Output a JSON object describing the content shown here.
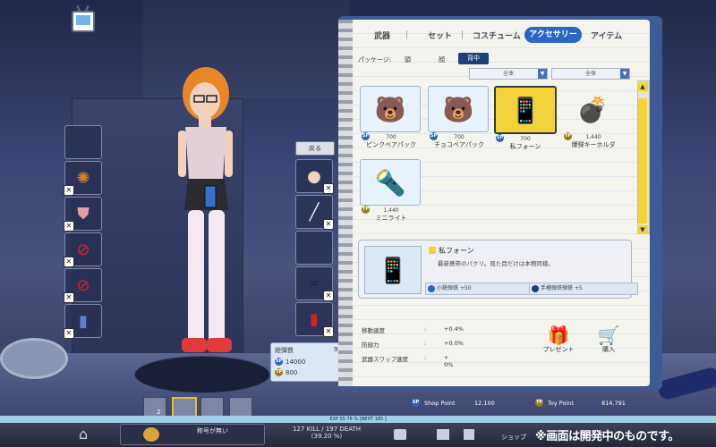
{
  "tabs": {
    "weapon": "武器",
    "set": "セット",
    "costume": "コスチューム",
    "accessory": "アクセサリー",
    "item": "アイテム"
  },
  "package": {
    "label": "パッケージ:",
    "head": "頭",
    "face": "顔",
    "back": "背中"
  },
  "filters": {
    "filter1": "全体",
    "filter2": "全体"
  },
  "items": [
    {
      "icon": "🐻",
      "price": "700",
      "currency": "SP",
      "name": "ピンクベアパック"
    },
    {
      "icon": "🐻",
      "price": "700",
      "currency": "SP",
      "name": "チョコベアパック"
    },
    {
      "icon": "📱",
      "price": "700",
      "currency": "SP",
      "name": "私フォーン"
    },
    {
      "icon": "💣",
      "price": "1,440",
      "currency": "TP",
      "name": "爆弾キーホルダ"
    },
    {
      "icon": "🔦",
      "price": "1,440",
      "currency": "TP",
      "name": "ミニライト"
    }
  ],
  "detail": {
    "name": "私フォーン",
    "description": "最新携帯のパクリ。見た目だけは本物同様。",
    "bonus1": "小銃弾鉄 +50",
    "bonus2": "手榴弾鉄弾鉄 +5"
  },
  "stats": [
    {
      "label": "移動速度",
      "colon": ":",
      "value": "+0.4%"
    },
    {
      "label": "防御力",
      "colon": ":",
      "value": "+0.0%"
    },
    {
      "label": "武器スワップ速度",
      "colon": ":",
      "value": "+ 0%"
    }
  ],
  "actions": {
    "present": "プレゼント",
    "buy": "購入"
  },
  "points": {
    "shop_label": "Shop Point",
    "shop_value": "12,100",
    "toy_label": "Toy Point",
    "toy_value": "814,791"
  },
  "left_panel": {
    "back_button": "戻る"
  },
  "tooltip": {
    "title": "総弾鉄",
    "count": "9",
    "sp_value": "14000",
    "tp_value": "800"
  },
  "footer": {
    "exp_text": "EXP 55.76 % [NEXT 185 ]",
    "title_text": "称号が無い",
    "kills": "127 KILL / 197 DEATH",
    "ratio": "(39.20 %)",
    "shop": "ショップ",
    "dev_notice": "※画面は開発中のものです。",
    "strip_badge": "2"
  },
  "colors": {
    "accent": "#2b66c4",
    "highlight": "#f3d33c",
    "notebook_cover": "#3e5b94"
  }
}
